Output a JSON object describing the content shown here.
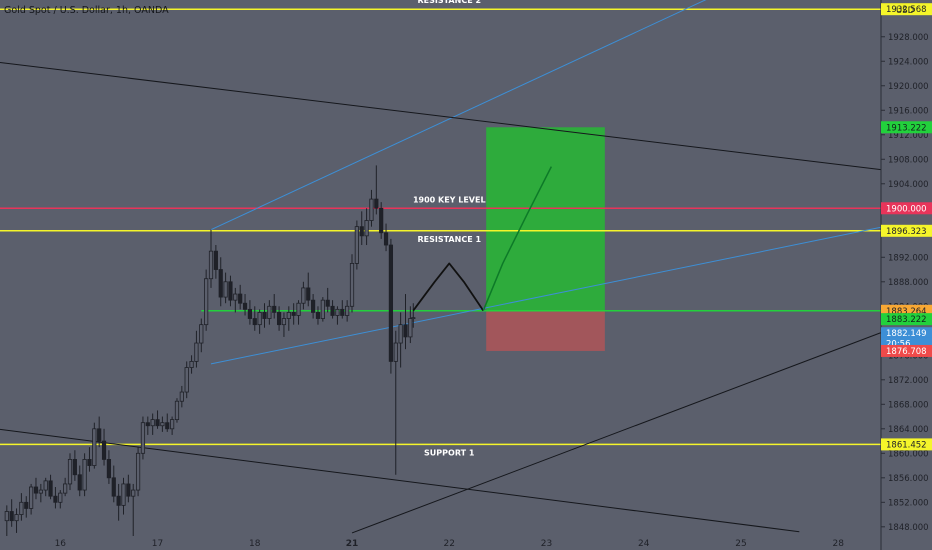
{
  "header": {
    "symbol_label": "Gold Spot / U.S. Dollar, 1h, OANDA"
  },
  "axis": {
    "currency_label": "USD"
  },
  "colors": {
    "background": "#5b5f6c",
    "axis_bg": "#5b5f6c",
    "axis_text": "#1f2128",
    "up_candle": "#1f2128",
    "down_candle": "#1f2128",
    "resistance_line": "#f5f52a",
    "key_level_line": "#e8345a",
    "entry_line": "#22d13c",
    "trendline_blue": "#3d8fd6",
    "trendline_black": "#15171c",
    "target_zone": "#2eab3c",
    "stop_zone": "#a2565b",
    "path_line": "#111111",
    "path_line_green": "#0d7a28"
  },
  "chart_data": {
    "type": "candlestick",
    "symbol": "Gold Spot / U.S. Dollar",
    "timeframe": "1h",
    "source": "OANDA",
    "currency": "USD",
    "y_range": [
      1846.5,
      1934.0
    ],
    "y_ticks": [
      "1928.000",
      "1924.000",
      "1920.000",
      "1916.000",
      "1912.000",
      "1908.000",
      "1904.000",
      "1900.000",
      "1896.000",
      "1892.000",
      "1888.000",
      "1884.000",
      "1880.000",
      "1876.000",
      "1872.000",
      "1868.000",
      "1864.000",
      "1860.000",
      "1856.000",
      "1852.000",
      "1848.000"
    ],
    "x_ticks": [
      {
        "label": "16",
        "day": 16
      },
      {
        "label": "17",
        "day": 17
      },
      {
        "label": "18",
        "day": 18
      },
      {
        "label": "21",
        "day": 19
      },
      {
        "label": "22",
        "day": 20
      },
      {
        "label": "23",
        "day": 21
      },
      {
        "label": "24",
        "day": 22
      },
      {
        "label": "25",
        "day": 23
      },
      {
        "label": "28",
        "day": 24
      }
    ],
    "x_range_days": [
      15.38,
      24.44
    ],
    "horizontal_levels": [
      {
        "label": "RESISTANCE 2",
        "price": 1932.5,
        "price_label": "1932.568",
        "color": "#f5f52a"
      },
      {
        "label": "1900 KEY LEVEL",
        "price": 1900.0,
        "price_label": "1900.000",
        "color": "#e8345a"
      },
      {
        "label": "RESISTANCE 1",
        "price": 1896.323,
        "price_label": "1896.323",
        "color": "#f5f52a"
      },
      {
        "label": "SUPPORT 1",
        "price": 1861.452,
        "price_label": "1861.452",
        "color": "#f5f52a"
      },
      {
        "label": "",
        "price": 1883.264,
        "price_label": "1883.264",
        "color": "#22d13c"
      }
    ],
    "price_tags": [
      {
        "price": 1913.222,
        "text": "1913.222",
        "bg": "#22d13c",
        "fg": "#10241a"
      },
      {
        "price": 1932.5,
        "text": "1932.568",
        "bg": "#f5f52a",
        "fg": "#1f2128"
      },
      {
        "price": 1900.0,
        "text": "1900.000",
        "bg": "#e8345a",
        "fg": "#ffffff"
      },
      {
        "price": 1896.323,
        "text": "1896.323",
        "bg": "#f5f52a",
        "fg": "#1f2128"
      },
      {
        "price": 1883.264,
        "text": "1883.264",
        "bg": "#f8a834",
        "fg": "#1f2128"
      },
      {
        "price": 1881.9,
        "text": "1883.222",
        "bg": "#22d13c",
        "fg": "#10241a"
      },
      {
        "price": 1879.6,
        "text": "1882.149",
        "bg": "#3d8fd6",
        "fg": "#ffffff"
      },
      {
        "price": 1877.9,
        "text": "20:56",
        "bg": "#3d8fd6",
        "fg": "#ffffff"
      },
      {
        "price": 1876.708,
        "text": "1876.708",
        "bg": "#ef4a4a",
        "fg": "#ffffff"
      },
      {
        "price": 1861.452,
        "text": "1861.452",
        "bg": "#f5f52a",
        "fg": "#1f2128"
      }
    ],
    "position": {
      "type": "long",
      "entry": 1883.264,
      "target": 1913.222,
      "stop": 1876.708,
      "start_day": 20.38,
      "end_day": 21.6
    },
    "trendlines": [
      {
        "color": "#3d8fd6",
        "points": [
          [
            17.55,
            1896.5
          ],
          [
            22.7,
            1934.5
          ]
        ]
      },
      {
        "color": "#3d8fd6",
        "points": [
          [
            17.55,
            1874.6
          ],
          [
            24.44,
            1896.9
          ]
        ]
      },
      {
        "color": "#15171c",
        "points": [
          [
            15.38,
            1923.8
          ],
          [
            24.44,
            1906.3
          ]
        ]
      },
      {
        "color": "#15171c",
        "points": [
          [
            15.38,
            1863.9
          ],
          [
            23.6,
            1847.2
          ]
        ]
      },
      {
        "color": "#15171c",
        "points": [
          [
            19.0,
            1847.0
          ],
          [
            24.44,
            1879.7
          ]
        ]
      }
    ],
    "projected_path": [
      [
        19.63,
        1883.3
      ],
      [
        19.85,
        1888.0
      ],
      [
        20.0,
        1891.0
      ],
      [
        20.15,
        1888.0
      ],
      [
        20.35,
        1883.3
      ]
    ],
    "projected_path_up": [
      [
        20.35,
        1883.3
      ],
      [
        20.55,
        1891.0
      ],
      [
        20.8,
        1899.0
      ],
      [
        21.05,
        1906.8
      ]
    ],
    "candles": [
      {
        "t": 15.45,
        "o": 1849.0,
        "h": 1851.5,
        "l": 1846.5,
        "c": 1850.5
      },
      {
        "t": 15.5,
        "o": 1850.5,
        "h": 1852.5,
        "l": 1848.0,
        "c": 1849.0
      },
      {
        "t": 15.55,
        "o": 1849.0,
        "h": 1851.0,
        "l": 1847.0,
        "c": 1850.0
      },
      {
        "t": 15.6,
        "o": 1850.0,
        "h": 1853.5,
        "l": 1849.0,
        "c": 1852.0
      },
      {
        "t": 15.65,
        "o": 1852.0,
        "h": 1853.0,
        "l": 1849.5,
        "c": 1851.0
      },
      {
        "t": 15.7,
        "o": 1851.0,
        "h": 1855.0,
        "l": 1850.0,
        "c": 1854.5
      },
      {
        "t": 15.75,
        "o": 1854.5,
        "h": 1856.0,
        "l": 1852.5,
        "c": 1853.5
      },
      {
        "t": 15.8,
        "o": 1853.5,
        "h": 1855.0,
        "l": 1852.0,
        "c": 1854.0
      },
      {
        "t": 15.85,
        "o": 1854.0,
        "h": 1856.0,
        "l": 1853.0,
        "c": 1855.5
      },
      {
        "t": 15.9,
        "o": 1855.5,
        "h": 1856.5,
        "l": 1852.5,
        "c": 1853.0
      },
      {
        "t": 15.95,
        "o": 1853.0,
        "h": 1854.5,
        "l": 1851.0,
        "c": 1852.0
      },
      {
        "t": 16.0,
        "o": 1852.0,
        "h": 1854.0,
        "l": 1851.0,
        "c": 1853.5
      },
      {
        "t": 16.05,
        "o": 1853.5,
        "h": 1856.0,
        "l": 1853.0,
        "c": 1855.0
      },
      {
        "t": 16.1,
        "o": 1855.0,
        "h": 1860.0,
        "l": 1854.0,
        "c": 1859.0
      },
      {
        "t": 16.15,
        "o": 1859.0,
        "h": 1860.5,
        "l": 1855.5,
        "c": 1856.5
      },
      {
        "t": 16.2,
        "o": 1856.5,
        "h": 1858.0,
        "l": 1853.0,
        "c": 1854.0
      },
      {
        "t": 16.25,
        "o": 1854.0,
        "h": 1860.0,
        "l": 1853.0,
        "c": 1859.0
      },
      {
        "t": 16.3,
        "o": 1859.0,
        "h": 1861.0,
        "l": 1857.0,
        "c": 1858.0
      },
      {
        "t": 16.35,
        "o": 1858.0,
        "h": 1865.0,
        "l": 1857.5,
        "c": 1864.0
      },
      {
        "t": 16.4,
        "o": 1864.0,
        "h": 1866.0,
        "l": 1861.0,
        "c": 1862.0
      },
      {
        "t": 16.45,
        "o": 1862.0,
        "h": 1864.0,
        "l": 1858.0,
        "c": 1859.0
      },
      {
        "t": 16.5,
        "o": 1859.0,
        "h": 1860.5,
        "l": 1855.0,
        "c": 1856.0
      },
      {
        "t": 16.55,
        "o": 1856.0,
        "h": 1858.0,
        "l": 1852.0,
        "c": 1853.0
      },
      {
        "t": 16.6,
        "o": 1853.0,
        "h": 1855.0,
        "l": 1849.0,
        "c": 1851.5
      },
      {
        "t": 16.65,
        "o": 1851.5,
        "h": 1856.0,
        "l": 1850.0,
        "c": 1855.0
      },
      {
        "t": 16.7,
        "o": 1855.0,
        "h": 1856.5,
        "l": 1852.0,
        "c": 1853.0
      },
      {
        "t": 16.75,
        "o": 1853.0,
        "h": 1855.0,
        "l": 1846.5,
        "c": 1854.0
      },
      {
        "t": 16.8,
        "o": 1854.0,
        "h": 1861.0,
        "l": 1853.0,
        "c": 1860.0
      },
      {
        "t": 16.85,
        "o": 1860.0,
        "h": 1866.0,
        "l": 1859.0,
        "c": 1865.0
      },
      {
        "t": 16.9,
        "o": 1865.0,
        "h": 1866.0,
        "l": 1863.0,
        "c": 1864.5
      },
      {
        "t": 16.95,
        "o": 1864.5,
        "h": 1866.5,
        "l": 1863.0,
        "c": 1865.5
      },
      {
        "t": 17.0,
        "o": 1865.5,
        "h": 1867.0,
        "l": 1864.0,
        "c": 1864.5
      },
      {
        "t": 17.05,
        "o": 1864.5,
        "h": 1866.0,
        "l": 1863.5,
        "c": 1865.0
      },
      {
        "t": 17.1,
        "o": 1865.0,
        "h": 1866.5,
        "l": 1863.5,
        "c": 1864.0
      },
      {
        "t": 17.15,
        "o": 1864.0,
        "h": 1866.0,
        "l": 1863.0,
        "c": 1865.5
      },
      {
        "t": 17.2,
        "o": 1865.5,
        "h": 1869.0,
        "l": 1865.0,
        "c": 1868.5
      },
      {
        "t": 17.25,
        "o": 1868.5,
        "h": 1871.0,
        "l": 1867.5,
        "c": 1870.0
      },
      {
        "t": 17.3,
        "o": 1870.0,
        "h": 1875.0,
        "l": 1869.0,
        "c": 1874.0
      },
      {
        "t": 17.35,
        "o": 1874.0,
        "h": 1876.0,
        "l": 1873.0,
        "c": 1875.0
      },
      {
        "t": 17.4,
        "o": 1875.0,
        "h": 1880.0,
        "l": 1874.0,
        "c": 1878.0
      },
      {
        "t": 17.45,
        "o": 1878.0,
        "h": 1882.0,
        "l": 1876.5,
        "c": 1881.0
      },
      {
        "t": 17.5,
        "o": 1881.0,
        "h": 1890.0,
        "l": 1880.0,
        "c": 1888.5
      },
      {
        "t": 17.55,
        "o": 1888.5,
        "h": 1896.5,
        "l": 1887.0,
        "c": 1893.0
      },
      {
        "t": 17.6,
        "o": 1893.0,
        "h": 1894.0,
        "l": 1888.5,
        "c": 1890.0
      },
      {
        "t": 17.65,
        "o": 1890.0,
        "h": 1892.0,
        "l": 1884.0,
        "c": 1885.5
      },
      {
        "t": 17.7,
        "o": 1885.5,
        "h": 1889.5,
        "l": 1884.5,
        "c": 1888.0
      },
      {
        "t": 17.75,
        "o": 1888.0,
        "h": 1889.0,
        "l": 1884.0,
        "c": 1885.0
      },
      {
        "t": 17.8,
        "o": 1885.0,
        "h": 1887.0,
        "l": 1883.0,
        "c": 1886.0
      },
      {
        "t": 17.85,
        "o": 1886.0,
        "h": 1887.5,
        "l": 1883.5,
        "c": 1884.5
      },
      {
        "t": 17.9,
        "o": 1884.5,
        "h": 1886.0,
        "l": 1882.5,
        "c": 1883.5
      },
      {
        "t": 17.95,
        "o": 1883.5,
        "h": 1885.0,
        "l": 1881.0,
        "c": 1882.0
      },
      {
        "t": 18.0,
        "o": 1882.0,
        "h": 1884.0,
        "l": 1880.0,
        "c": 1881.0
      },
      {
        "t": 18.05,
        "o": 1881.0,
        "h": 1883.5,
        "l": 1879.5,
        "c": 1883.0
      },
      {
        "t": 18.1,
        "o": 1883.0,
        "h": 1884.5,
        "l": 1880.5,
        "c": 1882.0
      },
      {
        "t": 18.15,
        "o": 1882.0,
        "h": 1885.0,
        "l": 1881.0,
        "c": 1884.0
      },
      {
        "t": 18.2,
        "o": 1884.0,
        "h": 1886.0,
        "l": 1882.0,
        "c": 1883.0
      },
      {
        "t": 18.25,
        "o": 1883.0,
        "h": 1884.0,
        "l": 1880.0,
        "c": 1881.0
      },
      {
        "t": 18.3,
        "o": 1881.0,
        "h": 1883.0,
        "l": 1879.0,
        "c": 1882.0
      },
      {
        "t": 18.35,
        "o": 1882.0,
        "h": 1884.0,
        "l": 1880.0,
        "c": 1883.0
      },
      {
        "t": 18.4,
        "o": 1883.0,
        "h": 1884.5,
        "l": 1881.0,
        "c": 1882.5
      },
      {
        "t": 18.45,
        "o": 1882.5,
        "h": 1885.0,
        "l": 1881.0,
        "c": 1884.5
      },
      {
        "t": 18.5,
        "o": 1884.5,
        "h": 1888.0,
        "l": 1883.5,
        "c": 1887.0
      },
      {
        "t": 18.55,
        "o": 1887.0,
        "h": 1889.5,
        "l": 1884.0,
        "c": 1885.0
      },
      {
        "t": 18.6,
        "o": 1885.0,
        "h": 1886.0,
        "l": 1882.0,
        "c": 1883.0
      },
      {
        "t": 18.65,
        "o": 1883.0,
        "h": 1884.0,
        "l": 1881.0,
        "c": 1882.0
      },
      {
        "t": 18.7,
        "o": 1882.0,
        "h": 1885.5,
        "l": 1881.5,
        "c": 1885.0
      },
      {
        "t": 18.75,
        "o": 1885.0,
        "h": 1887.0,
        "l": 1883.0,
        "c": 1884.0
      },
      {
        "t": 18.8,
        "o": 1884.0,
        "h": 1885.0,
        "l": 1882.0,
        "c": 1882.5
      },
      {
        "t": 18.85,
        "o": 1882.5,
        "h": 1884.0,
        "l": 1881.0,
        "c": 1883.5
      },
      {
        "t": 18.9,
        "o": 1883.5,
        "h": 1885.0,
        "l": 1882.0,
        "c": 1882.5
      },
      {
        "t": 18.95,
        "o": 1882.5,
        "h": 1885.0,
        "l": 1881.5,
        "c": 1884.0
      },
      {
        "t": 19.0,
        "o": 1884.0,
        "h": 1892.5,
        "l": 1883.0,
        "c": 1891.0
      },
      {
        "t": 19.05,
        "o": 1891.0,
        "h": 1898.0,
        "l": 1890.0,
        "c": 1897.0
      },
      {
        "t": 19.1,
        "o": 1897.0,
        "h": 1899.5,
        "l": 1894.0,
        "c": 1895.5
      },
      {
        "t": 19.15,
        "o": 1895.5,
        "h": 1900.0,
        "l": 1894.0,
        "c": 1898.0
      },
      {
        "t": 19.2,
        "o": 1898.0,
        "h": 1903.0,
        "l": 1897.0,
        "c": 1901.5
      },
      {
        "t": 19.25,
        "o": 1901.5,
        "h": 1907.0,
        "l": 1899.0,
        "c": 1900.0
      },
      {
        "t": 19.3,
        "o": 1900.0,
        "h": 1901.0,
        "l": 1895.0,
        "c": 1896.0
      },
      {
        "t": 19.35,
        "o": 1896.0,
        "h": 1897.5,
        "l": 1893.0,
        "c": 1894.0
      },
      {
        "t": 19.4,
        "o": 1894.0,
        "h": 1895.0,
        "l": 1873.0,
        "c": 1875.0
      },
      {
        "t": 19.45,
        "o": 1875.0,
        "h": 1880.0,
        "l": 1856.5,
        "c": 1878.0
      },
      {
        "t": 19.5,
        "o": 1878.0,
        "h": 1883.0,
        "l": 1874.0,
        "c": 1881.0
      },
      {
        "t": 19.55,
        "o": 1881.0,
        "h": 1886.0,
        "l": 1877.0,
        "c": 1879.0
      },
      {
        "t": 19.6,
        "o": 1879.0,
        "h": 1884.0,
        "l": 1878.0,
        "c": 1882.0
      },
      {
        "t": 19.63,
        "o": 1882.0,
        "h": 1884.5,
        "l": 1880.5,
        "c": 1882.149
      }
    ]
  }
}
